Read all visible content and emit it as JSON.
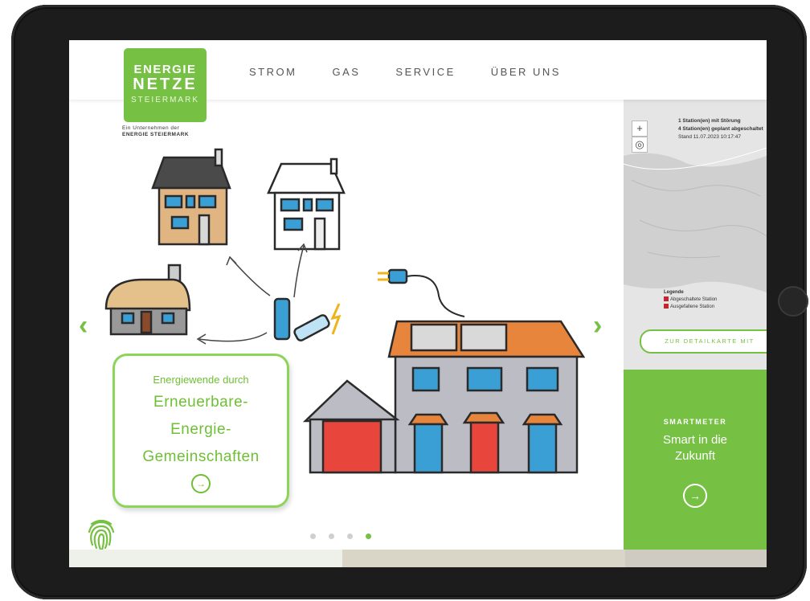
{
  "brand": {
    "logo_line1": "ENERGIE",
    "logo_line2": "NETZE",
    "logo_line3": "STEIERMARK",
    "tagline1": "Ein Unternehmen der",
    "tagline2": "ENERGIE STEIERMARK",
    "accent_color": "#76c043"
  },
  "nav": {
    "items": [
      {
        "label": "STROM"
      },
      {
        "label": "GAS"
      },
      {
        "label": "SERVICE"
      },
      {
        "label": "ÜBER UNS"
      }
    ]
  },
  "hero": {
    "prev_arrow": "‹",
    "next_arrow": "›",
    "card": {
      "small": "Energiewende durch",
      "line1": "Erneuerbare-",
      "line2": "Energie-",
      "line3": "Gemeinschaften",
      "cta_icon": "→"
    },
    "slides": {
      "count": 4,
      "active": 4
    }
  },
  "map": {
    "zoom_in": "+",
    "locate": "◎",
    "status_line1": "1 Station(en) mit Störung",
    "status_line2": "4 Station(en) geplant abgeschaltet",
    "stand": "Stand 11.07.2023 10:17:47",
    "legend_title": "Legende",
    "legend_item1": "Abgeschaltete Station",
    "legend_item2": "Ausgefallene Station",
    "detail_button": "ZUR DETAILKARTE MIT",
    "status_color": "#c0262d"
  },
  "smartmeter": {
    "label": "SMARTMETER",
    "title_line1": "Smart in die",
    "title_line2": "Zukunft",
    "cta_icon": "→"
  },
  "icons": [
    "fingerprint-icon",
    "arrow-right-circle-icon",
    "chevron-left-icon",
    "chevron-right-icon",
    "zoom-in-icon",
    "locate-icon"
  ]
}
